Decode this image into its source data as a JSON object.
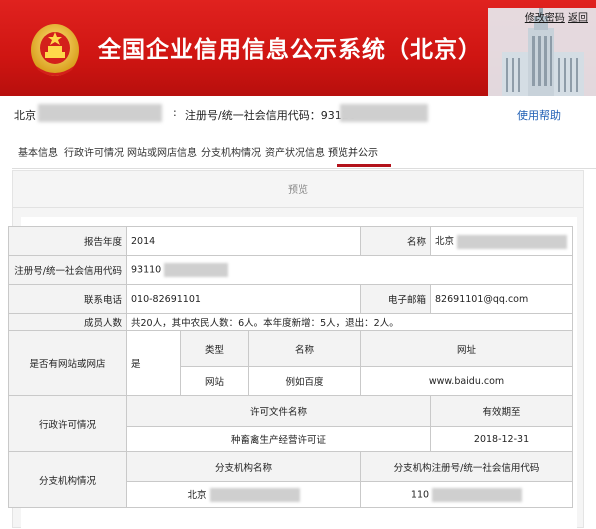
{
  "header": {
    "title": "全国企业信用信息公示系统（北京）",
    "link_change_password": "修改密码",
    "link_return": "返回"
  },
  "company": {
    "location": "北京",
    "colon": ":",
    "reg_label": "注册号/统一社会信用代码：93110",
    "help": "使用帮助"
  },
  "tabs": [
    {
      "label": "基本信息"
    },
    {
      "label": "行政许可情况"
    },
    {
      "label": "网站或网店信息"
    },
    {
      "label": "分支机构情况"
    },
    {
      "label": "资产状况信息"
    },
    {
      "label": "预览并公示"
    }
  ],
  "preview_label": "预览",
  "report": {
    "year_label": "报告年度",
    "year_value": "2014",
    "name_label": "名称",
    "name_value": "北京",
    "reg_label": "注册号/统一社会信用代码",
    "reg_value": "93110",
    "phone_label": "联系电话",
    "phone_value": "010-82691101",
    "email_label": "电子邮箱",
    "email_value": "82691101@qq.com",
    "members_label": "成员人数",
    "members_value": "共20人，其中农民人数：6人。本年度新增：5人，退出：2人。",
    "website_label": "是否有网站或网店",
    "website_flag": "是",
    "website_headers": [
      "类型",
      "名称",
      "网址"
    ],
    "website_row": [
      "网站",
      "例如百度",
      "www.baidu.com"
    ],
    "permit_label": "行政许可情况",
    "permit_headers": [
      "许可文件名称",
      "有效期至"
    ],
    "permit_row": [
      "种畜禽生产经营许可证",
      "2018-12-31"
    ],
    "branch_label": "分支机构情况",
    "branch_headers": [
      "分支机构名称",
      "分支机构注册号/统一社会信用代码"
    ],
    "branch_row": [
      "北京",
      "110"
    ]
  }
}
